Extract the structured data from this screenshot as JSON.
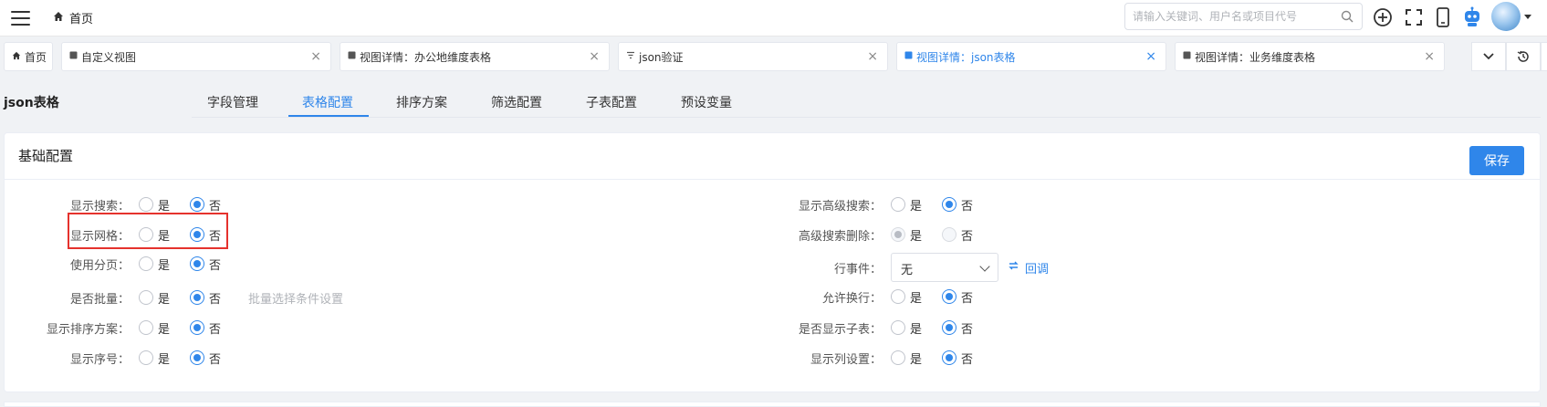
{
  "header": {
    "home_label": "首页",
    "search_placeholder": "请输入关键词、用户名或项目代号"
  },
  "tabs": [
    {
      "label": "首页",
      "icon": "home-icon",
      "closable": false
    },
    {
      "label": "自定义视图",
      "icon": "view-icon",
      "closable": true
    },
    {
      "label": "视图详情：办公地维度表格",
      "icon": "view-icon",
      "closable": true
    },
    {
      "label": "json验证",
      "icon": "filter-icon",
      "closable": true
    },
    {
      "label": "视图详情：json表格",
      "icon": "view-icon",
      "closable": true,
      "active": true
    },
    {
      "label": "视图详情：业务维度表格",
      "icon": "view-icon",
      "closable": true
    }
  ],
  "view": {
    "title": "json表格",
    "subtabs": [
      "字段管理",
      "表格配置",
      "排序方案",
      "筛选配置",
      "子表配置",
      "预设变量"
    ],
    "active_subtab": "表格配置"
  },
  "card": {
    "title": "基础配置",
    "save_label": "保存"
  },
  "options": {
    "yes": "是",
    "no": "否"
  },
  "left_settings": [
    {
      "label": "显示搜索：",
      "value": "否"
    },
    {
      "label": "显示网格：",
      "value": "否"
    },
    {
      "label": "使用分页：",
      "value": "否"
    },
    {
      "label": "是否批量：",
      "value": "否",
      "hint": "批量选择条件设置"
    },
    {
      "label": "显示排序方案：",
      "value": "否"
    },
    {
      "label": "显示序号：",
      "value": "否"
    }
  ],
  "right_settings": {
    "advanced_search": {
      "label": "显示高级搜索：",
      "value": "否"
    },
    "advanced_delete": {
      "label": "高级搜索删除：",
      "value": "是",
      "disabled": true
    },
    "row_event": {
      "label": "行事件：",
      "value": "无",
      "callback_label": "回调"
    },
    "wrap": {
      "label": "允许换行：",
      "value": "否"
    },
    "show_subtable": {
      "label": "是否显示子表：",
      "value": "否"
    },
    "column_settings": {
      "label": "显示列设置：",
      "value": "否"
    }
  },
  "colors": {
    "accent": "#2f86ea",
    "highlight": "#e5322d"
  }
}
